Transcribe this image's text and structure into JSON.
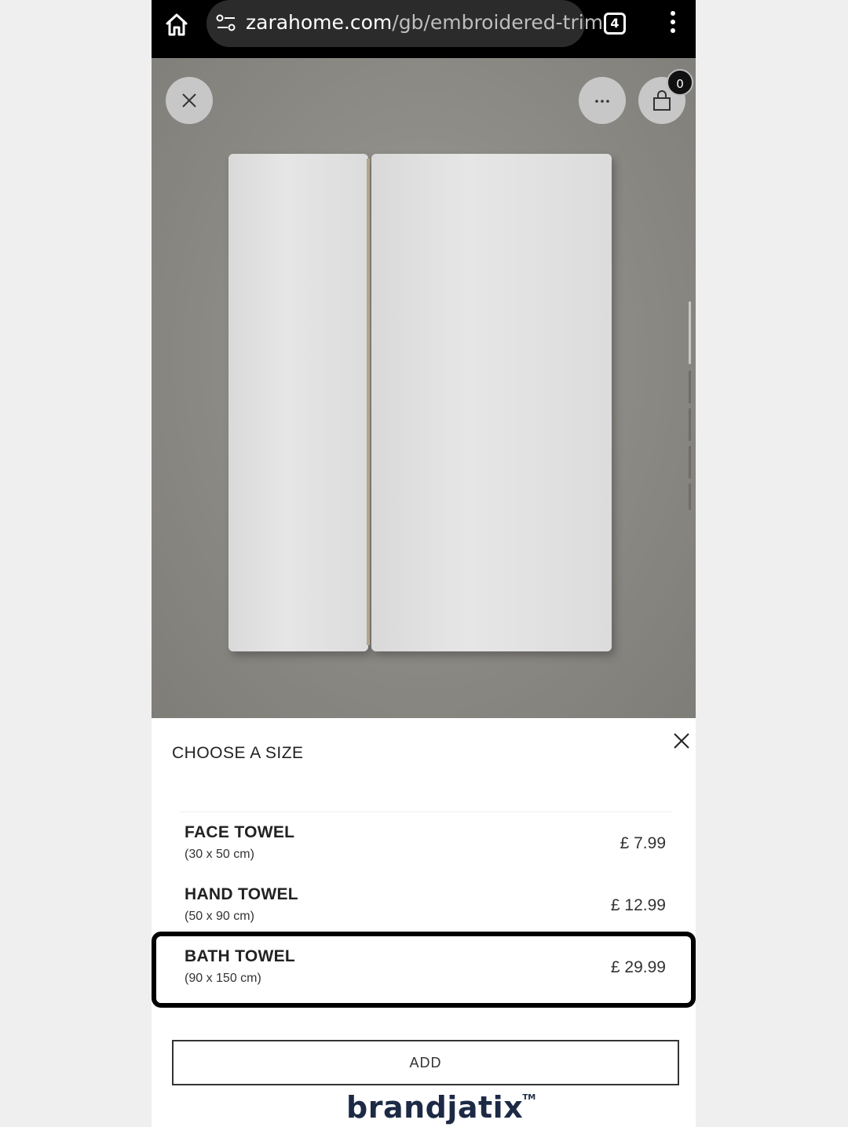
{
  "browser": {
    "url_domain": "zarahome.com",
    "url_path": "/gb/embroidered-trim",
    "tab_count": "4"
  },
  "hero": {
    "bag_count": "0",
    "close_icon": "close-icon",
    "more_icon": "more-horizontal-icon",
    "bag_icon": "shopping-bag-icon"
  },
  "size_sheet": {
    "title": "CHOOSE A SIZE",
    "options": [
      {
        "name": "FACE TOWEL",
        "dims": "(30 x 50 cm)",
        "price": "£ 7.99"
      },
      {
        "name": "HAND TOWEL",
        "dims": "(50 x 90 cm)",
        "price": "£ 12.99"
      },
      {
        "name": "BATH TOWEL",
        "dims": "(90 x 150 cm)",
        "price": "£ 29.99"
      }
    ],
    "add_label": "ADD"
  },
  "watermark": {
    "text": "brandjatix",
    "tm": "TM"
  }
}
